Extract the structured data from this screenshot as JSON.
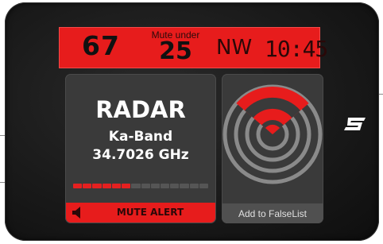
{
  "status_bar": {
    "speed": "67",
    "mute_under_label": "Mute under",
    "mute_under_value": "25",
    "heading": "NW",
    "time": "10:45"
  },
  "alert": {
    "type": "RADAR",
    "band": "Ka-Band",
    "frequency": "34.7026 GHz",
    "signal_strength_fraction": 0.43,
    "mute_button_label": "MUTE ALERT"
  },
  "radar": {
    "icon": "radar-waves-icon",
    "false_list_button_label": "Add to FalseList"
  },
  "icons": {
    "speaker": "speaker-icon",
    "logo": "brand-logo-icon"
  },
  "colors": {
    "alert_red": "#e71c1c",
    "panel_gray": "#3a3a3a",
    "device_body": "#1a1a1a",
    "meter_on": "#e52020",
    "meter_off": "#555555"
  }
}
